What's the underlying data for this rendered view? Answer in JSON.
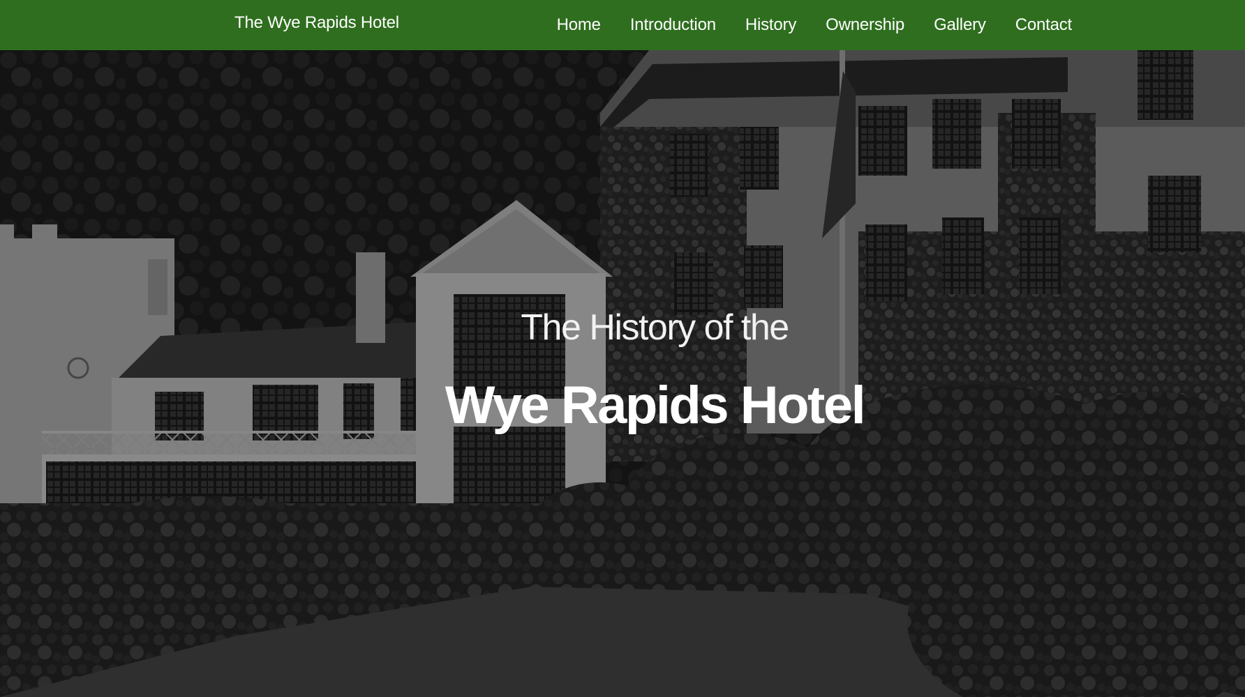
{
  "navbar": {
    "brand": "The Wye Rapids Hotel",
    "links": [
      {
        "label": "Home"
      },
      {
        "label": "Introduction"
      },
      {
        "label": "History"
      },
      {
        "label": "Ownership"
      },
      {
        "label": "Gallery"
      },
      {
        "label": "Contact"
      }
    ]
  },
  "hero": {
    "subtitle": "The History of the",
    "title": "Wye Rapids Hotel"
  },
  "colors": {
    "navbar_bg": "#2f6e1f",
    "nav_text": "#ffffff",
    "hero_text": "#ffffff"
  }
}
